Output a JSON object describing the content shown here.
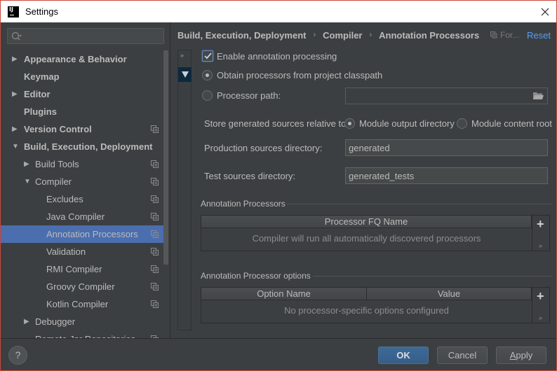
{
  "window": {
    "title": "Settings",
    "app_icon": "intellij-logo-icon",
    "logo_text": "IJ",
    "close_icon": "close-icon"
  },
  "sidebar": {
    "search": {
      "value": "",
      "placeholder": ""
    },
    "items": [
      {
        "label": "Appearance & Behavior",
        "level": 0,
        "arrow": "right",
        "project_icon": false
      },
      {
        "label": "Keymap",
        "level": 0,
        "arrow": "none",
        "project_icon": false
      },
      {
        "label": "Editor",
        "level": 0,
        "arrow": "right",
        "project_icon": false
      },
      {
        "label": "Plugins",
        "level": 0,
        "arrow": "none",
        "project_icon": false
      },
      {
        "label": "Version Control",
        "level": 0,
        "arrow": "right",
        "project_icon": true
      },
      {
        "label": "Build, Execution, Deployment",
        "level": 0,
        "arrow": "down",
        "project_icon": false
      },
      {
        "label": "Build Tools",
        "level": 1,
        "arrow": "right",
        "project_icon": true
      },
      {
        "label": "Compiler",
        "level": 1,
        "arrow": "down",
        "project_icon": true
      },
      {
        "label": "Excludes",
        "level": 2,
        "arrow": "none",
        "project_icon": true
      },
      {
        "label": "Java Compiler",
        "level": 2,
        "arrow": "none",
        "project_icon": true
      },
      {
        "label": "Annotation Processors",
        "level": 2,
        "arrow": "none",
        "project_icon": true,
        "selected": true
      },
      {
        "label": "Validation",
        "level": 2,
        "arrow": "none",
        "project_icon": true
      },
      {
        "label": "RMI Compiler",
        "level": 2,
        "arrow": "none",
        "project_icon": true
      },
      {
        "label": "Groovy Compiler",
        "level": 2,
        "arrow": "none",
        "project_icon": true
      },
      {
        "label": "Kotlin Compiler",
        "level": 2,
        "arrow": "none",
        "project_icon": true
      },
      {
        "label": "Debugger",
        "level": 1,
        "arrow": "right",
        "project_icon": false
      },
      {
        "label": "Remote Jar Repositories",
        "level": 1,
        "arrow": "none",
        "project_icon": true
      }
    ]
  },
  "header": {
    "breadcrumb": [
      "Build, Execution, Deployment",
      "Compiler",
      "Annotation Processors"
    ],
    "separator": "›",
    "for_project": "For...",
    "reset": "Reset"
  },
  "strip": {
    "expand": "››"
  },
  "content": {
    "enable_processing": {
      "label": "Enable annotation processing",
      "checked": true
    },
    "obtain_classpath": {
      "label": "Obtain processors from project classpath",
      "selected": true
    },
    "processor_path": {
      "label": "Processor path:",
      "selected": false,
      "value": ""
    },
    "store_relative": {
      "label": "Store generated sources relative to:",
      "options": [
        {
          "label": "Module output directory",
          "selected": true
        },
        {
          "label": "Module content root",
          "selected": false
        }
      ]
    },
    "production_dir": {
      "label": "Production sources directory:",
      "value": "generated"
    },
    "test_dir": {
      "label": "Test sources directory:",
      "value": "generated_tests"
    },
    "processors_section": {
      "title": "Annotation Processors",
      "columns": [
        "Processor FQ Name"
      ],
      "empty_text": "Compiler will run all automatically discovered processors",
      "add": "+",
      "more": "››"
    },
    "options_section": {
      "title": "Annotation Processor options",
      "columns": [
        "Option Name",
        "Value"
      ],
      "empty_text": "No processor-specific options configured",
      "add": "+",
      "more": "››"
    }
  },
  "footer": {
    "help": "?",
    "ok": "OK",
    "cancel": "Cancel",
    "apply_mnemonic": "A",
    "apply_rest": "pply"
  },
  "colors": {
    "accent": "#4b6eaf",
    "link": "#589df6",
    "background": "#3c3f41",
    "primary_button": "#365e88"
  }
}
